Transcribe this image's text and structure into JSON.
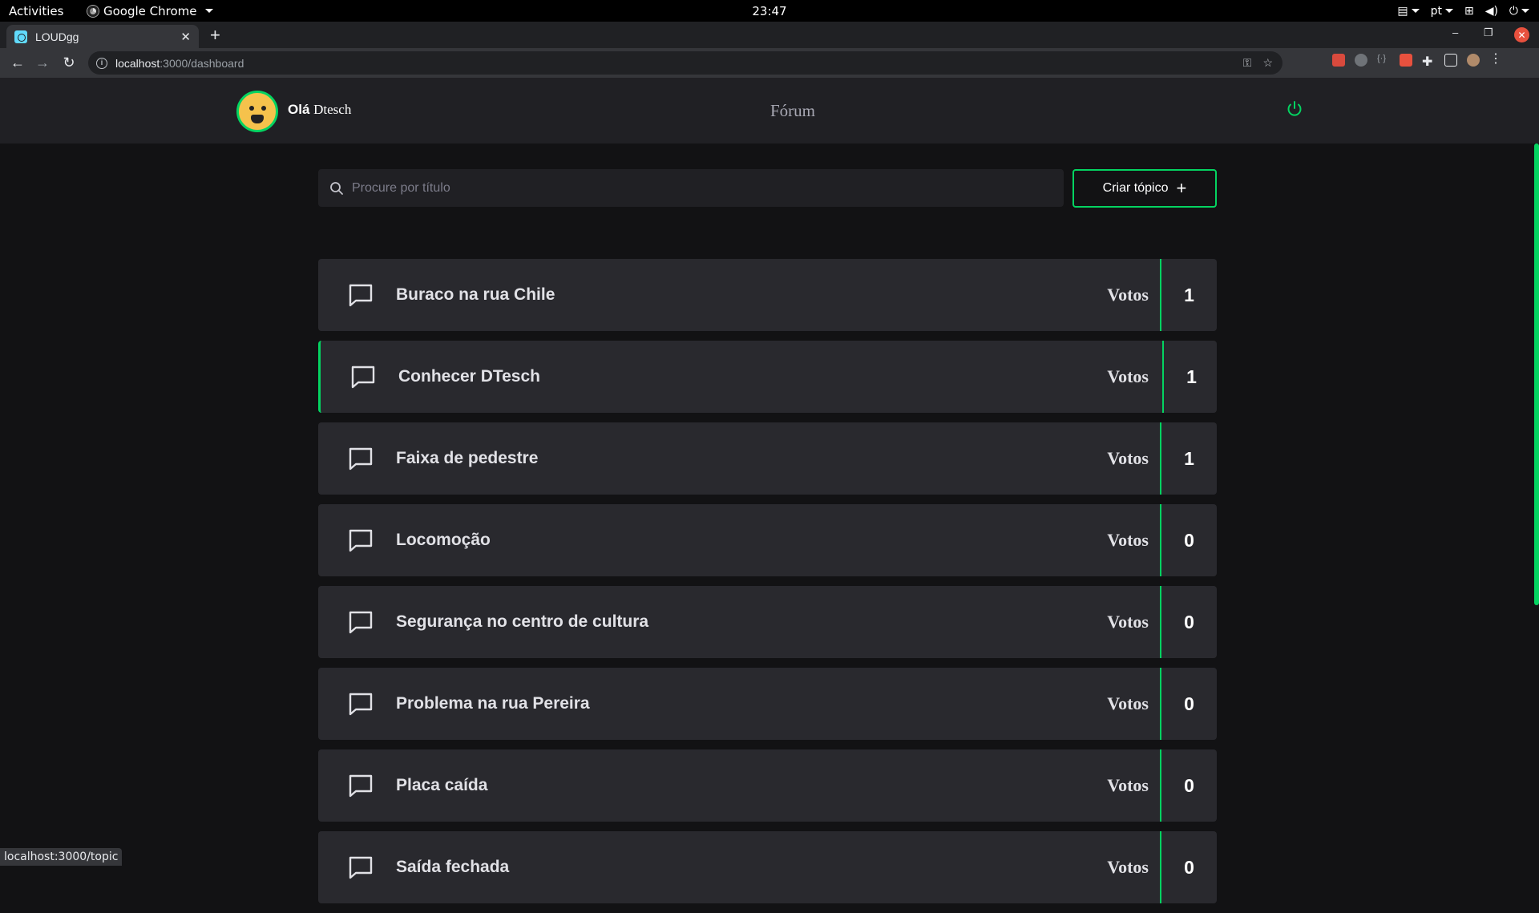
{
  "os": {
    "activities": "Activities",
    "app_name": "Google Chrome",
    "clock": "23:47",
    "lang": "pt"
  },
  "browser": {
    "tab_title": "LOUDgg",
    "url_host": "localhost",
    "url_path": ":3000/dashboard",
    "status_url": "localhost:3000/topic"
  },
  "header": {
    "greeting": "Olá",
    "username": "Dtesch",
    "nav_title": "Fórum"
  },
  "search": {
    "placeholder": "Procure por título"
  },
  "create_button": {
    "label": "Criar tópico"
  },
  "votes_label": "Votos",
  "topics": [
    {
      "title": "Buraco na rua Chile",
      "votes": "1",
      "active": false
    },
    {
      "title": "Conhecer DTesch",
      "votes": "1",
      "active": true
    },
    {
      "title": "Faixa de pedestre",
      "votes": "1",
      "active": false
    },
    {
      "title": "Locomoção",
      "votes": "0",
      "active": false
    },
    {
      "title": "Segurança no centro de cultura",
      "votes": "0",
      "active": false
    },
    {
      "title": "Problema na rua Pereira",
      "votes": "0",
      "active": false
    },
    {
      "title": "Placa caída",
      "votes": "0",
      "active": false
    },
    {
      "title": "Saída fechada",
      "votes": "0",
      "active": false
    }
  ],
  "colors": {
    "accent": "#04d361",
    "background": "#121214",
    "card": "#29292e",
    "header": "#202024"
  }
}
